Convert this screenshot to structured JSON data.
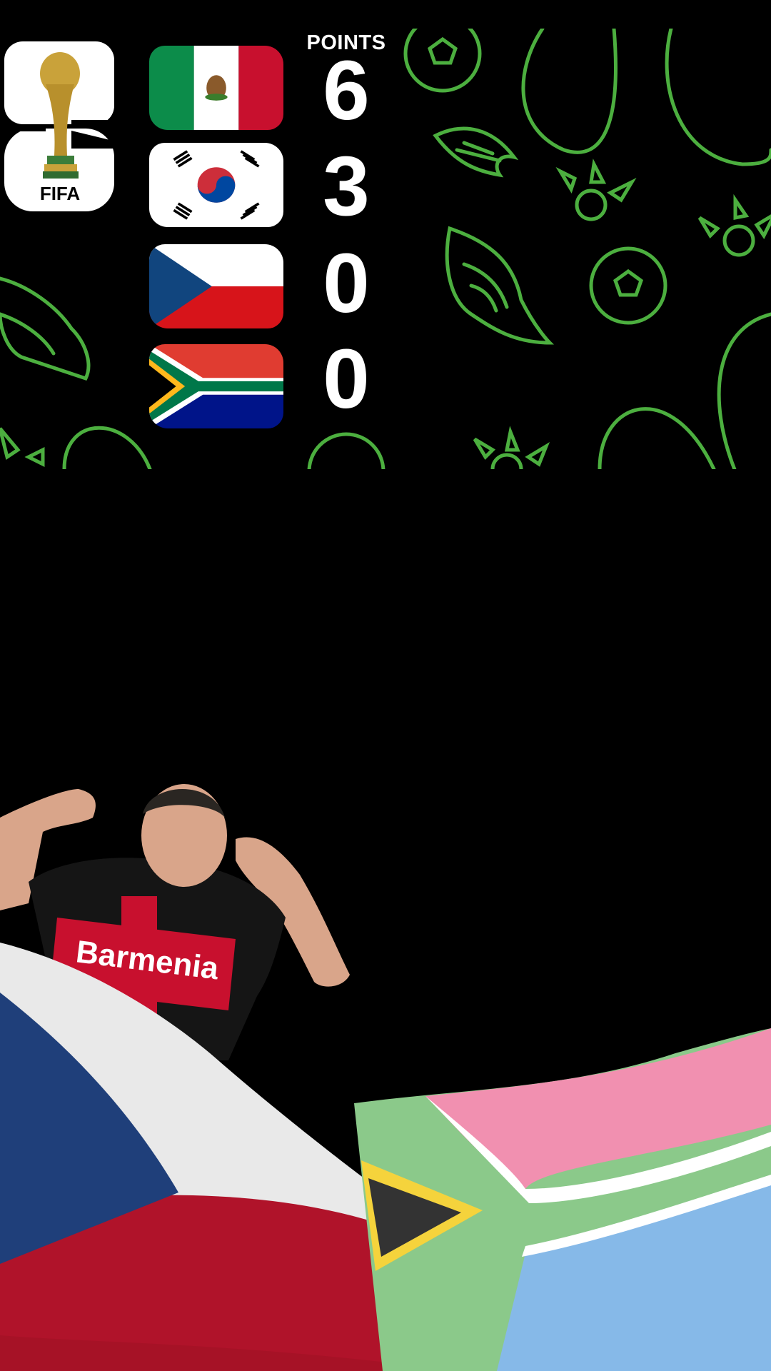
{
  "standings": {
    "header": "POINTS",
    "teams": [
      {
        "country": "Mexico",
        "flag_icon": "mexico-flag-icon",
        "points": "6"
      },
      {
        "country": "South Korea",
        "flag_icon": "south-korea-flag-icon",
        "points": "3"
      },
      {
        "country": "Czech Republic",
        "flag_icon": "czech-flag-icon",
        "points": "0"
      },
      {
        "country": "South Africa",
        "flag_icon": "south-africa-flag-icon",
        "points": "0"
      }
    ]
  },
  "logo": {
    "text": "FIFA",
    "icon": "world-cup-26-logo"
  },
  "player": {
    "shirt_text": "Barmenia"
  },
  "colors": {
    "pattern_green": "#4caf3f",
    "background": "#000000"
  }
}
